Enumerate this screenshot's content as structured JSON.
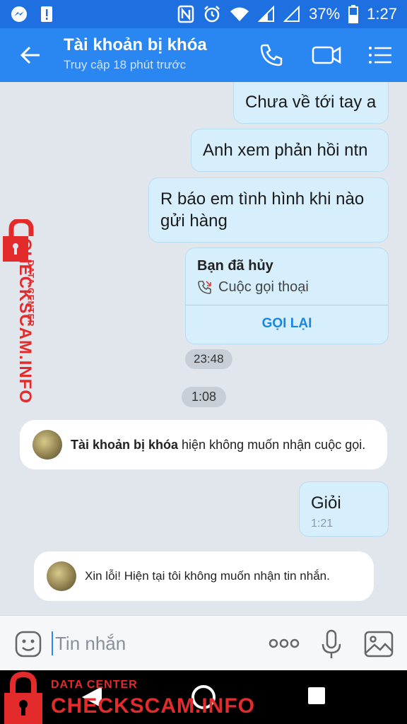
{
  "status_bar": {
    "battery": "37%",
    "time": "1:27"
  },
  "header": {
    "title": "Tài khoản bị khóa",
    "subtitle": "Truy cập 18 phút trước"
  },
  "messages": [
    {
      "text": "Chưa về tới tay a"
    },
    {
      "text": "Anh xem phản hồi ntn"
    },
    {
      "text": "R báo em tình hình khi nào gửi hàng"
    }
  ],
  "call_card": {
    "title": "Bạn đã hủy",
    "subtitle": "Cuộc gọi thoại",
    "action": "GỌI LẠI",
    "time": "23:48"
  },
  "time_divider": "1:08",
  "system_message_1": {
    "name": "Tài khoản bị khóa",
    "text": " hiện không muốn nhận cuộc gọi."
  },
  "reply": {
    "text": "Giỏi",
    "time": "1:21"
  },
  "system_message_2": {
    "text": "Xin lỗi! Hiện tại tôi không muốn nhận tin nhắn."
  },
  "input": {
    "placeholder": "Tin nhắn"
  },
  "watermark": {
    "small": "DATA CENTER",
    "big": "CHECKSCAM.INFO"
  },
  "colors": {
    "header": "#2a86f0",
    "status_bar": "#1e6fe0",
    "bubble": "#d7effd",
    "watermark": "#e32b2b"
  }
}
